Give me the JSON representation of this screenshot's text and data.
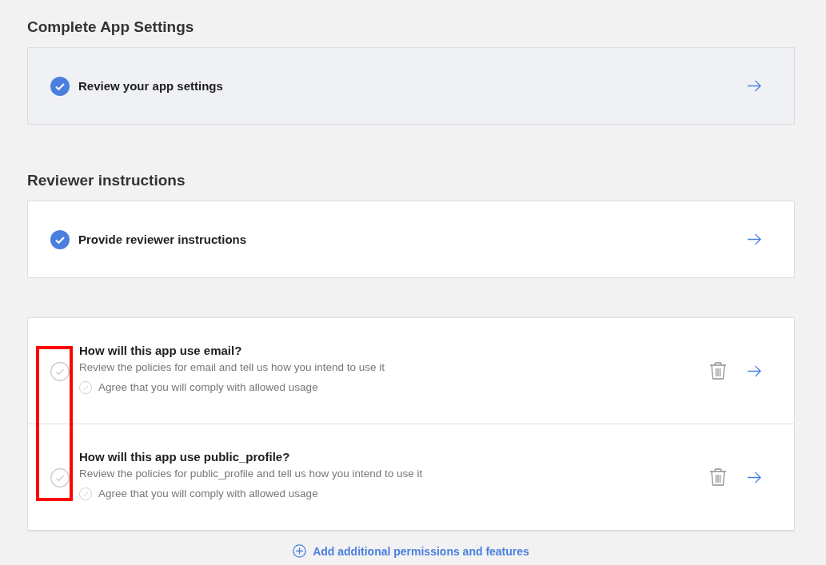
{
  "sections": [
    {
      "title": "Complete App Settings",
      "task": {
        "label": "Review your app settings",
        "done": true,
        "highlighted": true
      }
    },
    {
      "title": "Reviewer instructions",
      "task": {
        "label": "Provide reviewer instructions",
        "done": true,
        "highlighted": false
      }
    }
  ],
  "permissions": [
    {
      "title": "How will this app use email?",
      "description": "Review the policies for email and tell us how you intend to use it",
      "agreement": {
        "label": "Agree that you will comply with allowed usage",
        "checked": false
      },
      "done": false
    },
    {
      "title": "How will this app use public_profile?",
      "description": "Review the policies for public_profile and tell us how you intend to use it",
      "agreement": {
        "label": "Agree that you will comply with allowed usage",
        "checked": false
      },
      "done": false
    }
  ],
  "add_link": {
    "label": "Add additional permissions and features"
  },
  "annotation": {
    "kind": "highlight-box"
  }
}
